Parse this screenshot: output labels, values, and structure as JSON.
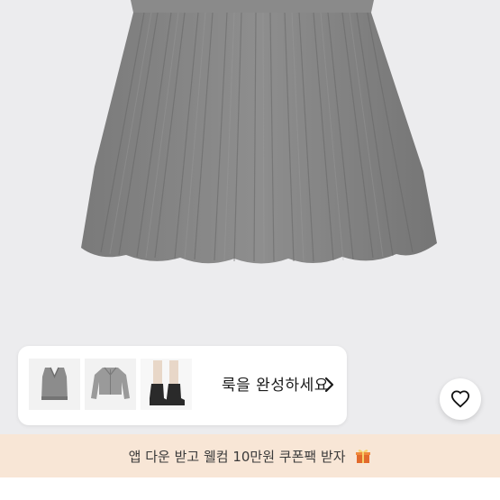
{
  "product_image": {
    "alt_name": "gray-pleated-skirt"
  },
  "look_card": {
    "label": "룩을 완성하세요",
    "items": [
      {
        "icon": "sweater-vest-icon"
      },
      {
        "icon": "cropped-jacket-icon"
      },
      {
        "icon": "ankle-boots-icon"
      }
    ]
  },
  "favorite": {
    "icon": "heart-icon"
  },
  "promo_banner": {
    "text": "앱 다운 받고 웰컴 10만원 쿠폰팩 받자",
    "icon": "gift-icon",
    "background": "#f8e6d6"
  }
}
